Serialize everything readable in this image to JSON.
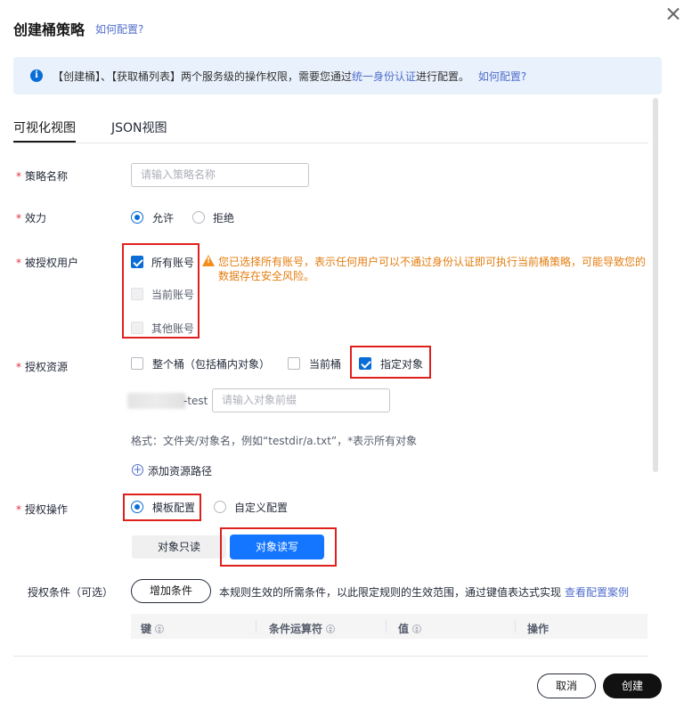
{
  "dialog": {
    "title": "创建桶策略",
    "title_link": "如何配置?",
    "close_icon": "close-icon"
  },
  "banner": {
    "icon": "info-icon",
    "text_prefix": "【创建桶】、【获取桶列表】两个服务级的操作权限，需要您通过",
    "link_iam": "统一身份认证",
    "text_suffix": "进行配置。",
    "link_howto": "如何配置?"
  },
  "tabs": [
    {
      "label": "可视化视图",
      "active": true
    },
    {
      "label": "JSON视图",
      "active": false
    }
  ],
  "form": {
    "policy_name": {
      "label": "策略名称",
      "placeholder": "请输入策略名称"
    },
    "effect": {
      "label": "效力",
      "options": [
        "允许",
        "拒绝"
      ],
      "selected": "允许"
    },
    "principal": {
      "label": "被授权用户",
      "options": [
        {
          "label": "所有账号",
          "checked": true,
          "disabled": false
        },
        {
          "label": "当前账号",
          "checked": false,
          "disabled": true
        },
        {
          "label": "其他账号",
          "checked": false,
          "disabled": true
        }
      ],
      "warning_icon": "warning-icon",
      "warning": "您已选择所有账号，表示任何用户可以不通过身份认证即可执行当前桶策略，可能导致您的数据存在安全风险。"
    },
    "resource": {
      "label": "授权资源",
      "options": [
        {
          "label": "整个桶（包括桶内对象）",
          "checked": false
        },
        {
          "label": "当前桶",
          "checked": false
        },
        {
          "label": "指定对象",
          "checked": true
        }
      ],
      "bucket_suffix": "-test",
      "prefix_placeholder": "请输入对象前缀",
      "format_hint": "格式：文件夹/对象名，例如“testdir/a.txt”，*表示所有对象",
      "add_path": "添加资源路径"
    },
    "action": {
      "label": "授权操作",
      "options": [
        "模板配置",
        "自定义配置"
      ],
      "selected": "模板配置",
      "templates": [
        "对象只读",
        "对象读写"
      ],
      "selected_template": "对象读写"
    },
    "condition": {
      "label": "授权条件（可选）",
      "add_button": "增加条件",
      "desc": "本规则生效的所需条件，以此限定规则的生效范围，通过键值表达式实现",
      "example_link": "查看配置案例",
      "columns": [
        "键",
        "条件运算符",
        "值",
        "操作"
      ]
    }
  },
  "footer": {
    "cancel": "取消",
    "create": "创建"
  }
}
